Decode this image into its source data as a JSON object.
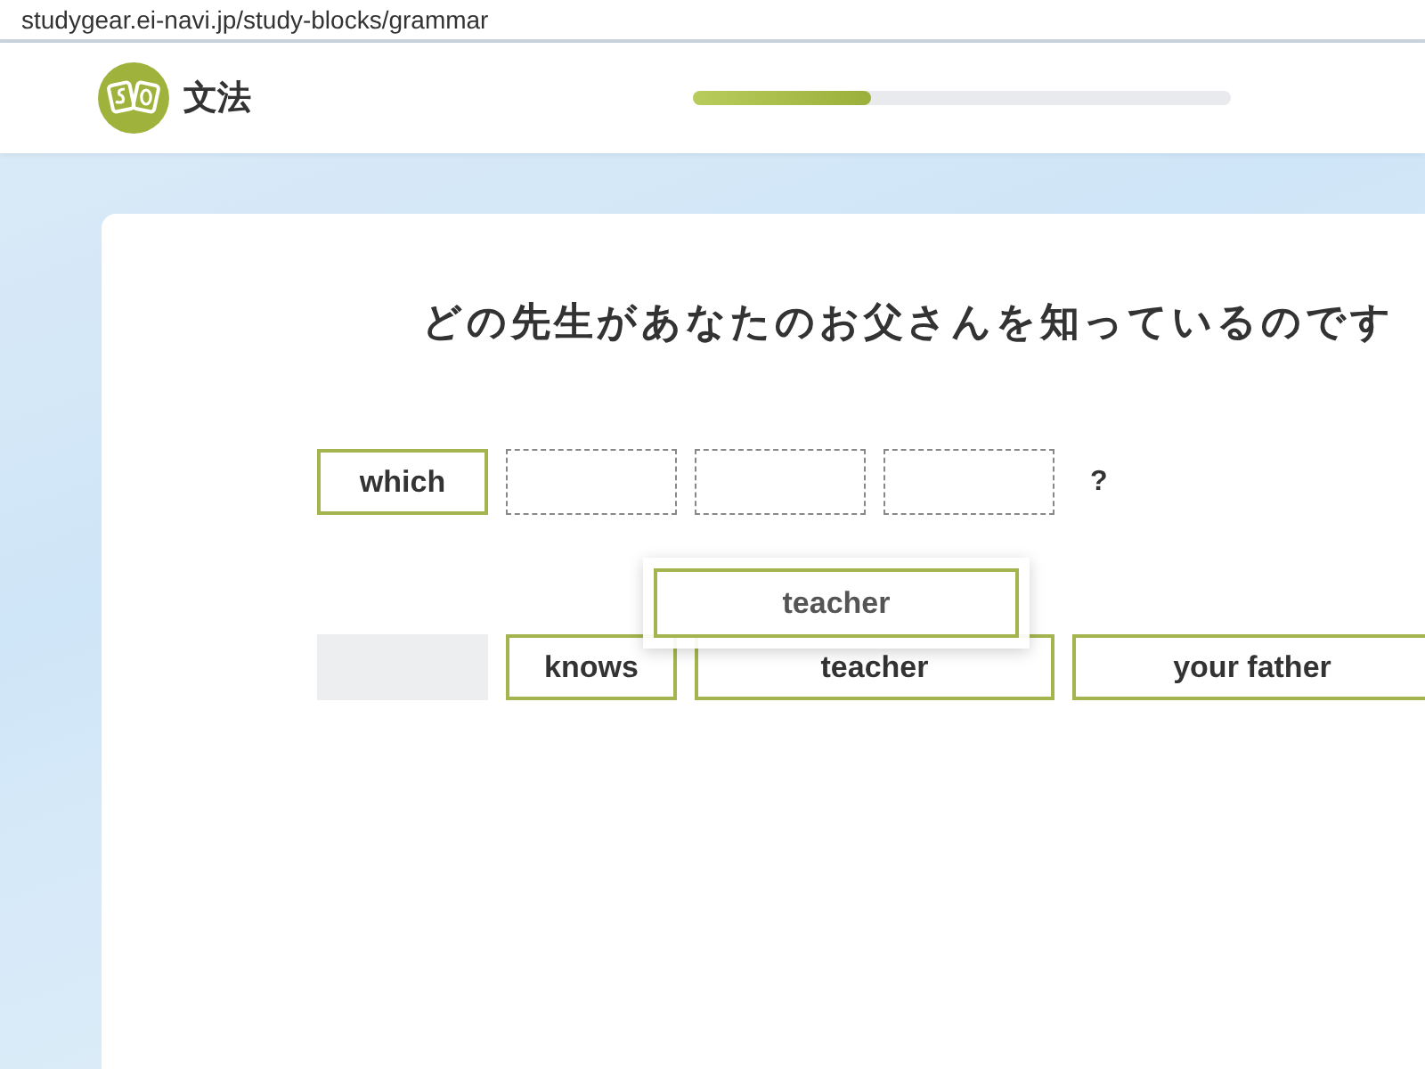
{
  "address_bar": {
    "url": "studygear.ei-navi.jp/study-blocks/grammar"
  },
  "header": {
    "title": "文法",
    "progress": {
      "level": 0.33
    }
  },
  "question": "どの先生があなたのお父さんを知っているのです",
  "answer_slots": [
    {
      "word": "which",
      "filled": true
    },
    {
      "filled": false
    },
    {
      "filled": false
    },
    {
      "filled": false
    }
  ],
  "answer_end": "?",
  "word_bank": [
    {
      "used": true
    },
    {
      "word": "knows",
      "used": false,
      "wide": false
    },
    {
      "word": "teacher",
      "used": false,
      "wide": true
    },
    {
      "word": "your father",
      "used": false,
      "wide": true
    }
  ],
  "dragged_tile": {
    "word": "teacher"
  }
}
